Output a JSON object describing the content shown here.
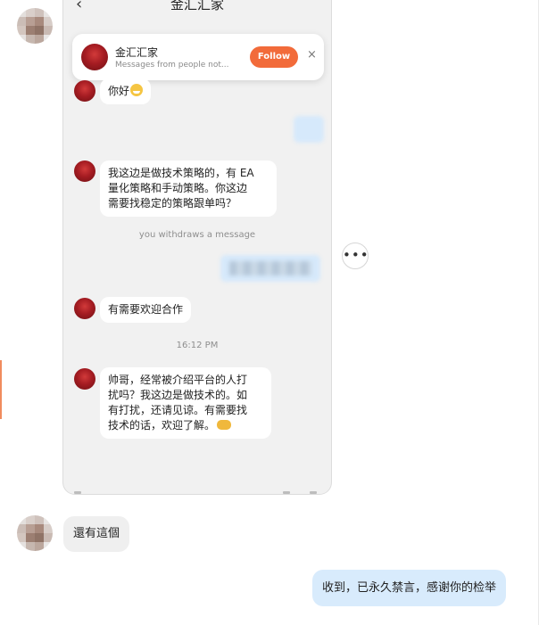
{
  "phone": {
    "title": "金汇汇家",
    "back_icon": "‹",
    "notification": {
      "name": "金汇汇家",
      "subtitle": "Messages from people not...",
      "follow_label": "Follow",
      "close_icon": "×"
    },
    "messages": [
      {
        "text": "你好"
      },
      {
        "text_lines": [
          "我这边是做技术策略的，有 EA",
          "量化策略和手动策略。你这边",
          "需要找稳定的策略跟单吗？"
        ]
      },
      {
        "text": "有需要欢迎合作"
      },
      {
        "text_lines": [
          "帅哥，经常被介绍平台的人打",
          "扰吗？我这边是做技术的。如",
          "有打扰，还请见谅。有需要找",
          "技术的话，欢迎了解。"
        ]
      }
    ],
    "system_withdraw": "you withdraws a message",
    "timestamp": "16:12 PM"
  },
  "more_icon": "•••",
  "outer_chat": {
    "incoming": "還有這個",
    "outgoing": "收到，已永久禁言，感谢你的检举"
  },
  "colors": {
    "follow": "#f26b3a",
    "outgoing_bubble": "#d8ebfc",
    "incoming_bubble": "#efefef",
    "accent_edge": "#f08c5e"
  }
}
